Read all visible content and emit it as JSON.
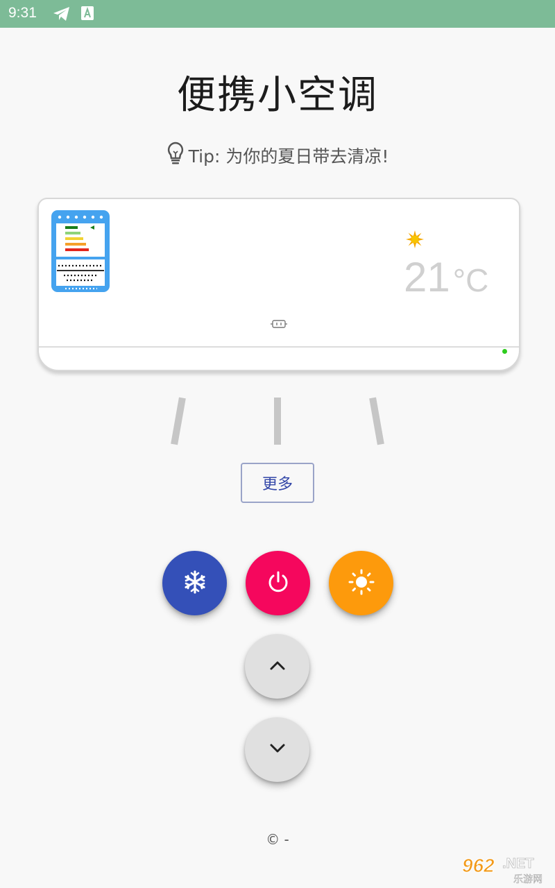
{
  "status_bar": {
    "time": "9:31",
    "icons": [
      "telegram-icon",
      "keyboard-a-icon"
    ]
  },
  "header": {
    "title": "便携小空调"
  },
  "tip": {
    "icon": "lightbulb-icon",
    "text": "Tip: 为你的夏日带去清凉!"
  },
  "ac_display": {
    "temperature": "21",
    "unit": "°C",
    "mode_icon": "sun-icon",
    "led_color": "#2ecc1e"
  },
  "controls": {
    "more_label": "更多",
    "cool_icon": "snowflake-icon",
    "power_icon": "power-icon",
    "heat_icon": "sun-icon",
    "up_icon": "chevron-up-icon",
    "down_icon": "chevron-down-icon"
  },
  "colors": {
    "status_bar": "#7dbb97",
    "cool": "#3450b8",
    "power": "#f5075d",
    "heat": "#fd9a0c",
    "accent": "#3347a8"
  },
  "footer": {
    "copyright": "© -"
  },
  "watermark": {
    "number": "962",
    "suffix": ".NET",
    "subtitle": "乐游网"
  }
}
